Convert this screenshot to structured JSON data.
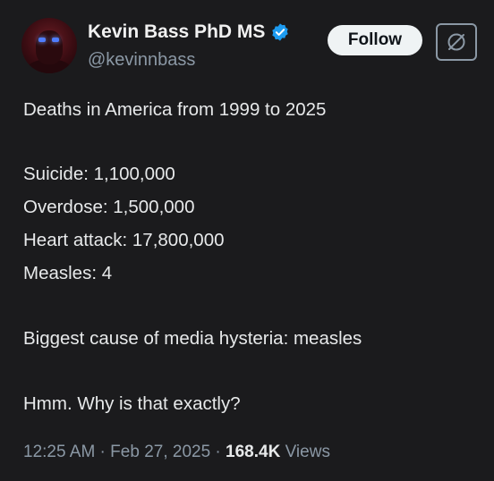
{
  "author": {
    "name": "Kevin Bass PhD MS",
    "handle": "@kevinnbass",
    "verified_color": "#1d9bf0"
  },
  "actions": {
    "follow_label": "Follow",
    "grok_icon": "grok-icon"
  },
  "tweet": {
    "lines": [
      "Deaths in America from 1999 to 2025",
      "Suicide: 1,100,000",
      "Overdose: 1,500,000",
      "Heart attack: 17,800,000",
      "Measles: 4",
      "Biggest cause of media hysteria: measles",
      "Hmm. Why is that exactly?"
    ]
  },
  "meta": {
    "time": "12:25 AM",
    "sep1": " · ",
    "date": "Feb 27, 2025",
    "sep2": " · ",
    "views_count": "168.4K",
    "views_label": " Views"
  }
}
